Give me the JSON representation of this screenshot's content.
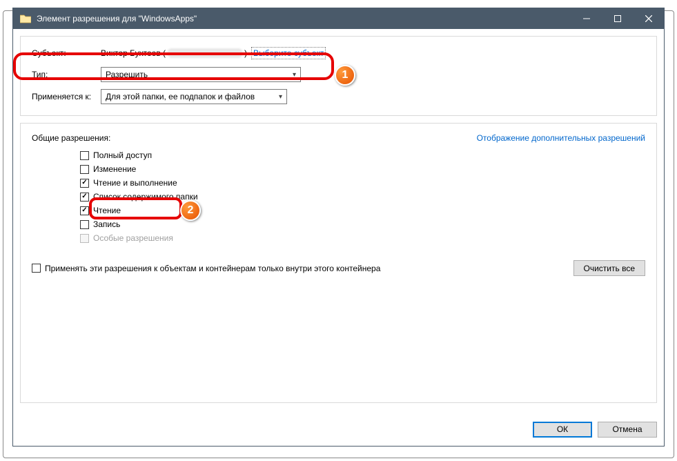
{
  "window": {
    "title": "Элемент разрешения для \"WindowsApps\""
  },
  "header": {
    "subject_label": "Субъект:",
    "subject_name": "Виктор Бухтеев (",
    "subject_name_end": ")",
    "select_subject_link": "Выберите субъект",
    "type_label": "Тип:",
    "type_value": "Разрешить",
    "applies_label": "Применяется к:",
    "applies_value": "Для этой папки, ее подпапок и файлов"
  },
  "permissions": {
    "heading": "Общие разрешения:",
    "advanced_link": "Отображение дополнительных разрешений",
    "items": [
      {
        "label": "Полный доступ",
        "checked": false,
        "disabled": false
      },
      {
        "label": "Изменение",
        "checked": false,
        "disabled": false
      },
      {
        "label": "Чтение и выполнение",
        "checked": true,
        "disabled": false
      },
      {
        "label": "Список содержимого папки",
        "checked": true,
        "disabled": false
      },
      {
        "label": "Чтение",
        "checked": true,
        "disabled": false
      },
      {
        "label": "Запись",
        "checked": false,
        "disabled": false
      },
      {
        "label": "Особые разрешения",
        "checked": false,
        "disabled": true
      }
    ],
    "apply_only_label": "Применять эти разрешения к объектам и контейнерам только внутри этого контейнера",
    "clear_all": "Очистить все"
  },
  "footer": {
    "ok": "ОК",
    "cancel": "Отмена"
  },
  "badges": {
    "one": "1",
    "two": "2"
  }
}
